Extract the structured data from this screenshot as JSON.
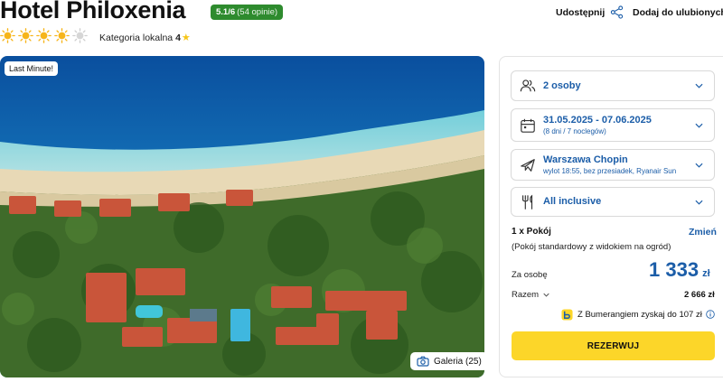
{
  "hotel": {
    "name": "Hotel Philoxenia",
    "rating": "5.1/6",
    "reviews": "(54 opinie)",
    "sun_rating": 4,
    "sun_max": 5,
    "local_category_label": "Kategoria lokalna",
    "local_category_value": "4"
  },
  "actions": {
    "share_label": "Udostępnij",
    "favorite_label": "Dodaj do ulubionych"
  },
  "media": {
    "badge": "Last Minute!",
    "gallery_label": "Galeria (25)"
  },
  "booking": {
    "persons": "2 osoby",
    "dates": "31.05.2025 - 07.06.2025",
    "dates_sub": "(8 dni / 7 noclegów)",
    "departure": "Warszawa Chopin",
    "departure_sub": "wylot 18:55, bez przesiadek, Ryanair Sun",
    "board": "All inclusive",
    "room_count": "1 x Pokój",
    "change_label": "Zmień",
    "room_desc": "(Pokój standardowy z widokiem na ogród)",
    "per_person_label": "Za osobę",
    "price": "1 333",
    "currency": "zł",
    "total_label": "Razem",
    "total_value": "2 666 zł",
    "bumerang_text": "Z Bumerangiem zyskaj do 107 zł",
    "reserve_label": "REZERWUJ"
  },
  "colors": {
    "accent": "#1b5da8",
    "rating_badge": "#2e8b2e",
    "cta": "#fcd629",
    "sun": "#f6b51a"
  }
}
